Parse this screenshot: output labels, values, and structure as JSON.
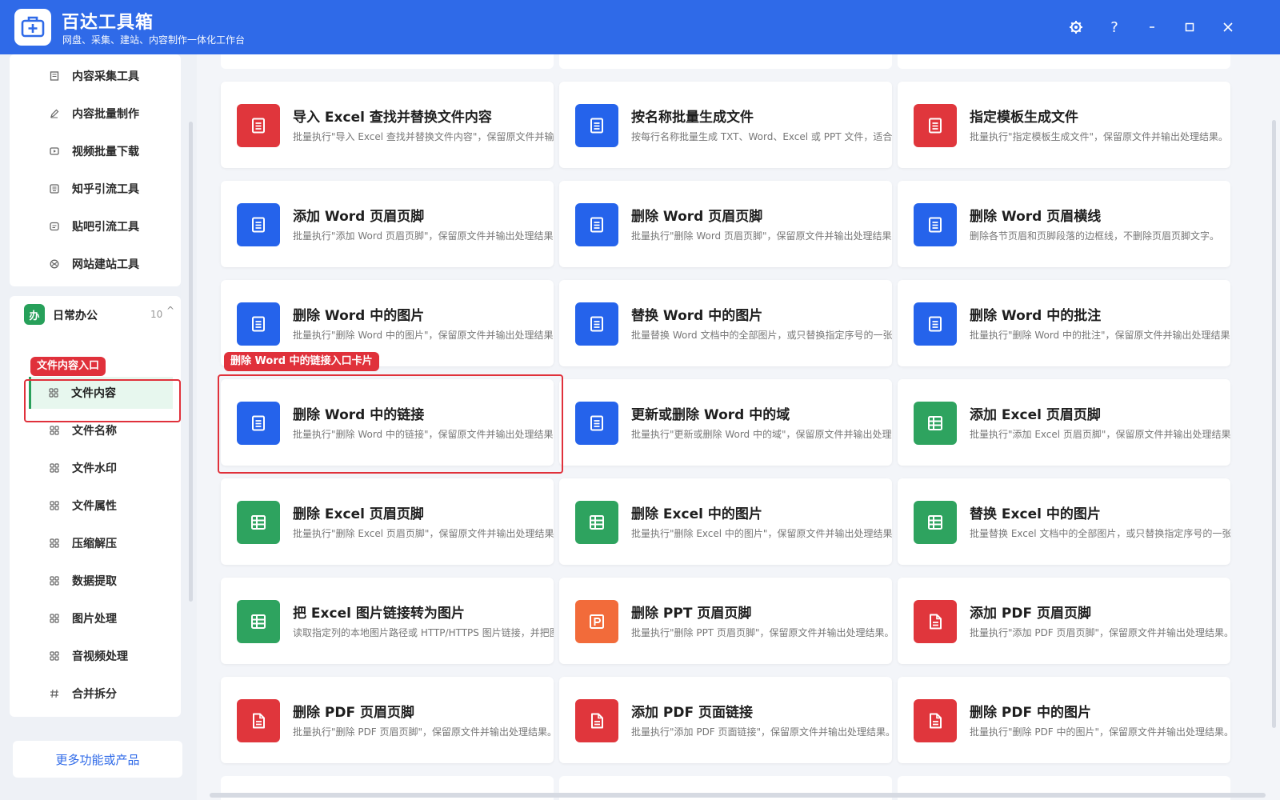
{
  "app": {
    "title": "百达工具箱",
    "subtitle": "网盘、采集、建站、内容制作一体化工作台"
  },
  "window_controls": [
    "settings",
    "help",
    "minimize",
    "maximize",
    "close"
  ],
  "sidebar": {
    "top_items": [
      {
        "label": "内容采集工具",
        "icon": "document-icon"
      },
      {
        "label": "内容批量制作",
        "icon": "pen-icon"
      },
      {
        "label": "视频批量下载",
        "icon": "video-icon"
      },
      {
        "label": "知乎引流工具",
        "icon": "zhihu-icon"
      },
      {
        "label": "贴吧引流工具",
        "icon": "tieba-icon"
      },
      {
        "label": "网站建站工具",
        "icon": "globe-icon"
      }
    ],
    "group": {
      "badge": "办",
      "title": "日常办公",
      "count": "10",
      "caret": "^"
    },
    "group_items": [
      {
        "label": "文件内容",
        "icon": "grid-icon",
        "active": true
      },
      {
        "label": "文件名称",
        "icon": "grid-icon"
      },
      {
        "label": "文件水印",
        "icon": "grid-icon"
      },
      {
        "label": "文件属性",
        "icon": "grid-icon"
      },
      {
        "label": "压缩解压",
        "icon": "grid-icon"
      },
      {
        "label": "数据提取",
        "icon": "grid-icon"
      },
      {
        "label": "图片处理",
        "icon": "grid-icon"
      },
      {
        "label": "音视频处理",
        "icon": "grid-icon"
      },
      {
        "label": "合并拆分",
        "icon": "hash-icon"
      }
    ],
    "more_button": "更多功能或产品"
  },
  "annotations": {
    "sidebar_tag": "文件内容入口",
    "card_tag": "删除 Word 中的链接入口卡片"
  },
  "colors": {
    "titlebar": "#2f6ae8",
    "blue": "#2563eb",
    "red": "#e0363c",
    "green": "#2ea35f",
    "orange": "#f26b3a",
    "annotation": "#e0313b"
  },
  "cards": [
    {
      "title": "导入 Excel 查找并替换文件内容",
      "desc": "批量执行\"导入 Excel 查找并替换文件内容\"，保留原文件并输出处理结果。",
      "color": "red",
      "icon": "document-icon"
    },
    {
      "title": "按名称批量生成文件",
      "desc": "按每行名称批量生成 TXT、Word、Excel 或 PPT 文件，适合批量创建文件。",
      "color": "blue",
      "icon": "document-icon"
    },
    {
      "title": "指定模板生成文件",
      "desc": "批量执行\"指定模板生成文件\"，保留原文件并输出处理结果。",
      "color": "red",
      "icon": "document-icon"
    },
    {
      "title": "添加 Word 页眉页脚",
      "desc": "批量执行\"添加 Word 页眉页脚\"，保留原文件并输出处理结果。",
      "color": "blue",
      "icon": "document-icon"
    },
    {
      "title": "删除 Word 页眉页脚",
      "desc": "批量执行\"删除 Word 页眉页脚\"，保留原文件并输出处理结果。",
      "color": "blue",
      "icon": "document-icon"
    },
    {
      "title": "删除 Word 页眉横线",
      "desc": "删除各节页眉和页脚段落的边框线，不删除页眉页脚文字。",
      "color": "blue",
      "icon": "document-icon"
    },
    {
      "title": "删除 Word 中的图片",
      "desc": "批量执行\"删除 Word 中的图片\"，保留原文件并输出处理结果。",
      "color": "blue",
      "icon": "document-icon"
    },
    {
      "title": "替换 Word 中的图片",
      "desc": "批量替换 Word 文档中的全部图片，或只替换指定序号的一张图片。",
      "color": "blue",
      "icon": "document-icon"
    },
    {
      "title": "删除 Word 中的批注",
      "desc": "批量执行\"删除 Word 中的批注\"，保留原文件并输出处理结果。",
      "color": "blue",
      "icon": "document-icon"
    },
    {
      "title": "删除 Word 中的链接",
      "desc": "批量执行\"删除 Word 中的链接\"，保留原文件并输出处理结果。",
      "color": "blue",
      "icon": "document-icon"
    },
    {
      "title": "更新或删除 Word 中的域",
      "desc": "批量执行\"更新或删除 Word 中的域\"，保留原文件并输出处理结果。",
      "color": "blue",
      "icon": "document-icon"
    },
    {
      "title": "添加 Excel 页眉页脚",
      "desc": "批量执行\"添加 Excel 页眉页脚\"，保留原文件并输出处理结果。",
      "color": "green",
      "icon": "table-icon"
    },
    {
      "title": "删除 Excel 页眉页脚",
      "desc": "批量执行\"删除 Excel 页眉页脚\"，保留原文件并输出处理结果。",
      "color": "green",
      "icon": "table-icon"
    },
    {
      "title": "删除 Excel 中的图片",
      "desc": "批量执行\"删除 Excel 中的图片\"，保留原文件并输出处理结果。",
      "color": "green",
      "icon": "table-icon"
    },
    {
      "title": "替换 Excel 中的图片",
      "desc": "批量替换 Excel 文档中的全部图片，或只替换指定序号的一张图片。",
      "color": "green",
      "icon": "table-icon"
    },
    {
      "title": "把 Excel 图片链接转为图片",
      "desc": "读取指定列的本地图片路径或 HTTP/HTTPS 图片链接，并把图片嵌入表格。",
      "color": "green",
      "icon": "table-icon"
    },
    {
      "title": "删除 PPT 页眉页脚",
      "desc": "批量执行\"删除 PPT 页眉页脚\"，保留原文件并输出处理结果。",
      "color": "orange",
      "icon": "ppt-icon"
    },
    {
      "title": "添加 PDF 页眉页脚",
      "desc": "批量执行\"添加 PDF 页眉页脚\"，保留原文件并输出处理结果。",
      "color": "red",
      "icon": "pdf-icon"
    },
    {
      "title": "删除 PDF 页眉页脚",
      "desc": "批量执行\"删除 PDF 页眉页脚\"，保留原文件并输出处理结果。",
      "color": "red",
      "icon": "pdf-icon"
    },
    {
      "title": "添加 PDF 页面链接",
      "desc": "批量执行\"添加 PDF 页面链接\"，保留原文件并输出处理结果。",
      "color": "red",
      "icon": "pdf-icon"
    },
    {
      "title": "删除 PDF 中的图片",
      "desc": "批量执行\"删除 PDF 中的图片\"，保留原文件并输出处理结果。",
      "color": "red",
      "icon": "pdf-icon"
    }
  ]
}
